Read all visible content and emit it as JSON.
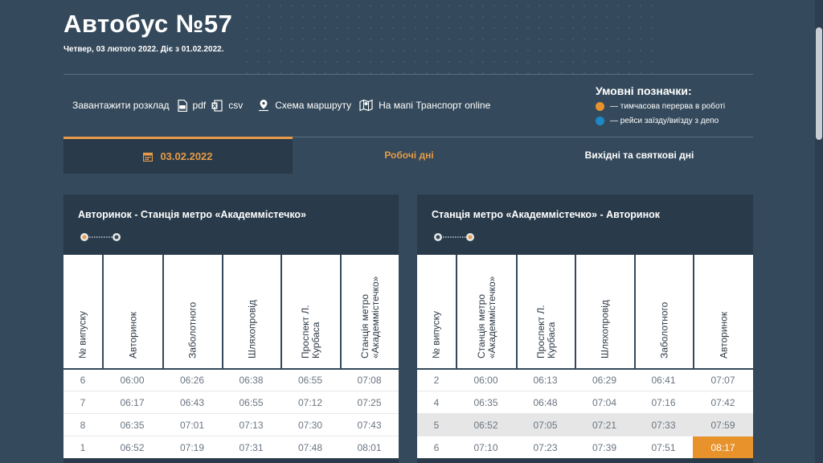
{
  "header": {
    "title": "Автобус №57",
    "subtitle": "Четвер, 03 лютого 2022. Діє з 01.02.2022."
  },
  "toolbar": {
    "download_label": "Завантажити розклад",
    "pdf_label": "pdf",
    "csv_label": "csv",
    "route_scheme_label": "Схема маршруту",
    "map_label": "На мапі Транспорт online"
  },
  "legend": {
    "title": "Умовні позначки:",
    "items": [
      {
        "label": "— тимчасова перерва в роботі",
        "color": "#e8922c"
      },
      {
        "label": "— рейси заїзду/виїзду з депо",
        "color": "#1e88c7"
      }
    ]
  },
  "tabs": {
    "date": "03.02.2022",
    "workdays": "Робочі дні",
    "weekend": "Вихідні та святкові дні"
  },
  "colors": {
    "accent": "#e79b46",
    "background": "#34495b",
    "panel": "#293a4a",
    "highlight": "#e8922c",
    "depot": "#1e88c7"
  },
  "left_table": {
    "title": "Авторинок - Станція метро «Академмістечко»",
    "columns": [
      "№ випуску",
      "Авторинок",
      "Заболотного",
      "Шляхопровід",
      "Проспект Л. Курбаса",
      "Станція метро «Академмістечко»"
    ],
    "rows": [
      [
        "6",
        "06:00",
        "06:26",
        "06:38",
        "06:55",
        "07:08"
      ],
      [
        "7",
        "06:17",
        "06:43",
        "06:55",
        "07:12",
        "07:25"
      ],
      [
        "8",
        "06:35",
        "07:01",
        "07:13",
        "07:30",
        "07:43"
      ],
      [
        "1",
        "06:52",
        "07:19",
        "07:31",
        "07:48",
        "08:01"
      ]
    ]
  },
  "right_table": {
    "title": "Станція метро «Академмістечко» - Авторинок",
    "columns": [
      "№ випуску",
      "Станція метро «Академмістечко»",
      "Проспект Л. Курбаса",
      "Шляхопровід",
      "Заболотного",
      "Авторинок"
    ],
    "rows": [
      [
        "2",
        "06:00",
        "06:13",
        "06:29",
        "06:41",
        "07:07"
      ],
      [
        "4",
        "06:35",
        "06:48",
        "07:04",
        "07:16",
        "07:42"
      ],
      [
        "5",
        "06:52",
        "07:05",
        "07:21",
        "07:33",
        "07:59"
      ],
      [
        "6",
        "07:10",
        "07:23",
        "07:39",
        "07:51",
        "08:17"
      ]
    ]
  }
}
